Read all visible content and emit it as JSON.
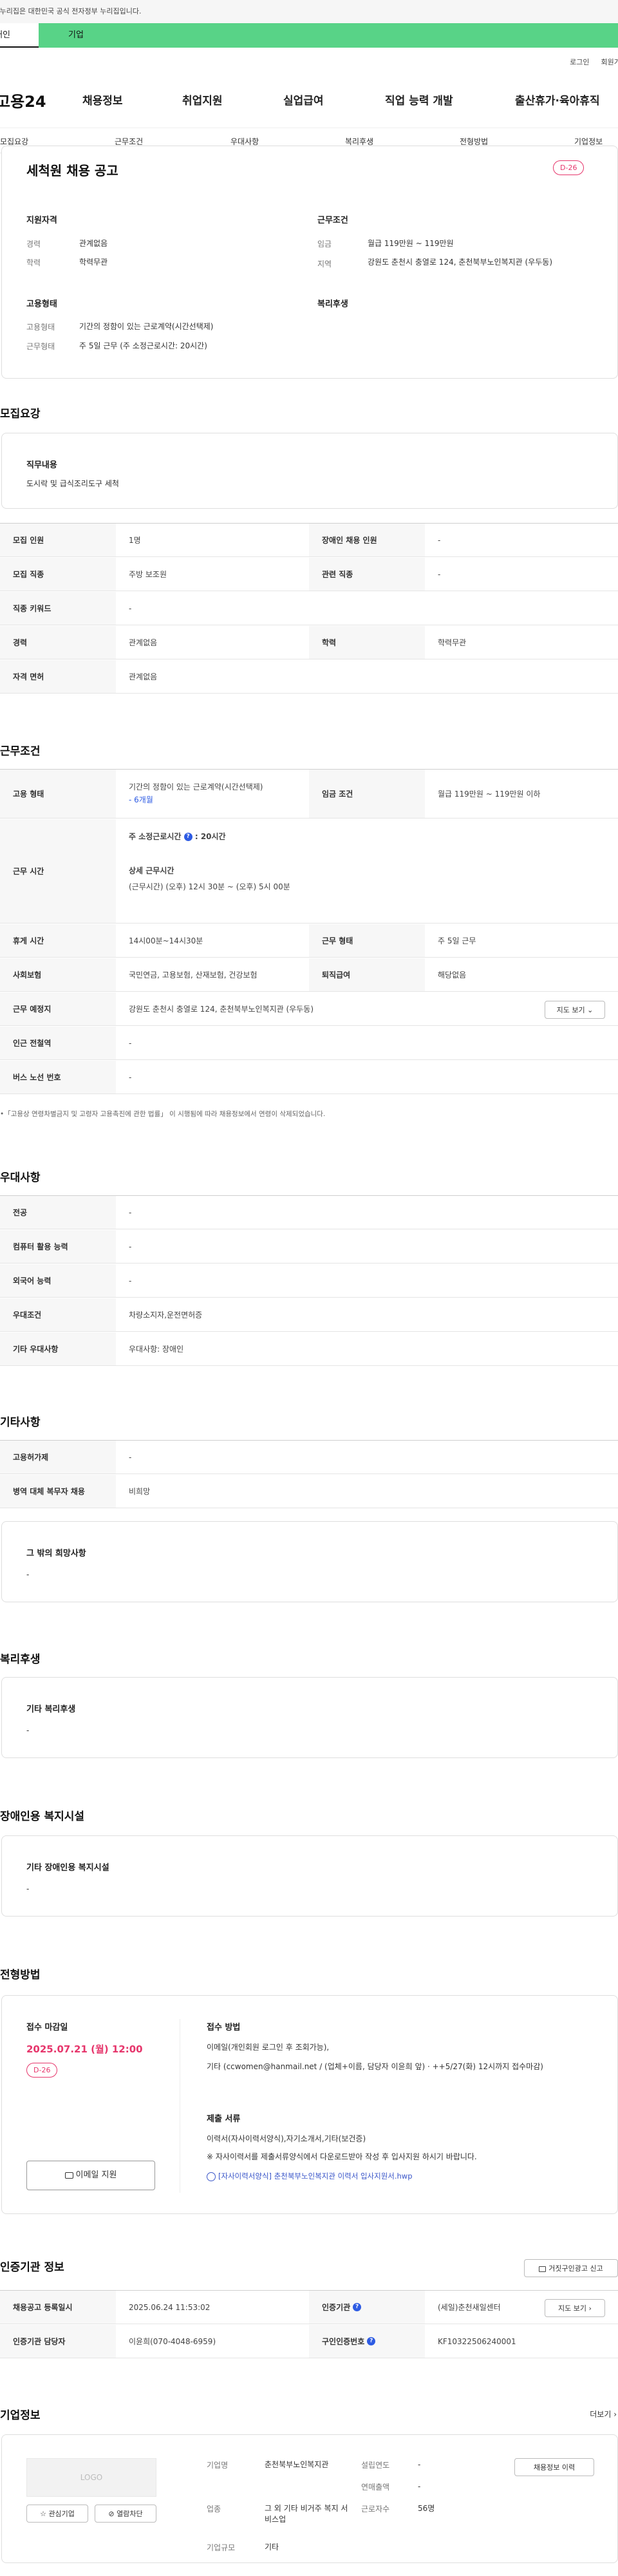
{
  "gov_banner": "이 누리집은 대한민국 공식 전자정부 누리집입니다.",
  "tabs": {
    "person": "개인",
    "company": "기업"
  },
  "utility": {
    "login": "로그인",
    "join": "회원가입"
  },
  "logo": "고용24",
  "gnb": [
    "채용정보",
    "취업지원",
    "실업급여",
    "직업 능력 개발",
    "출산휴가·육아휴직"
  ],
  "subnav": [
    "모집요강",
    "근무조건",
    "우대사항",
    "복리후생",
    "전형방법",
    "기업정보"
  ],
  "summary": {
    "title": "세척원 채용 공고",
    "dday": "D-26",
    "qualify_title": "지원자격",
    "career_k": "경력",
    "career_v": "관계없음",
    "edu_k": "학력",
    "edu_v": "학력무관",
    "cond_title": "근무조건",
    "wage_k": "임금",
    "wage_v": "월급 119만원 ~ 119만원",
    "region_k": "지역",
    "region_v": "강원도 춘천시 충열로 124, 춘천북부노인복지관 (우두동)",
    "emp_title": "고용형태",
    "emptype_k": "고용형태",
    "emptype_v": "기간의 정함이 있는 근로계약(시간선택제)",
    "worktype_k": "근무형태",
    "worktype_v": "주 5일 근무 (주 소정근로시간: 20시간)",
    "welfare_title": "복리후생"
  },
  "recruit": {
    "title": "모집요강",
    "duty_title": "직무내용",
    "duty_text": "도시락 및 급식조리도구 세척",
    "rows": [
      {
        "k1": "모집 인원",
        "v1": "1명",
        "k2": "장애인 채용 인원",
        "v2": "-"
      },
      {
        "k1": "모집 직종",
        "v1": "주방 보조원",
        "k2": "관련 직종",
        "v2": "-"
      },
      {
        "k1": "직종 키워드",
        "v1": "-"
      },
      {
        "k1": "경력",
        "v1": "관계없음",
        "k2": "학력",
        "v2": "학력무관"
      },
      {
        "k1": "자격 면허",
        "v1": "관계없음"
      }
    ]
  },
  "work": {
    "title": "근무조건",
    "emp_k": "고용 형태",
    "emp_v": "기간의 정함이 있는 근로계약(시간선택제)",
    "emp_period": "- 6개월",
    "wage_k": "임금 조건",
    "wage_v": "월급 119만원 ~ 119만원 이하",
    "time_k": "근무 시간",
    "time_hours_label": "주 소정근로시간",
    "time_hours_value": ": 20시간",
    "time_detail_label": "상세 근무시간",
    "time_detail_value": "(근무시간) (오후) 12시 30분 ~ (오후) 5시 00분",
    "rest_k": "휴게 시간",
    "rest_v": "14시00분~14시30분",
    "form_k": "근무 형태",
    "form_v": "주 5일 근무",
    "ins_k": "사회보험",
    "ins_v": "국민연금, 고용보험, 산재보험, 건강보험",
    "sev_k": "퇴직급여",
    "sev_v": "해당없음",
    "place_k": "근무 예정지",
    "place_v": "강원도 춘천시 충열로 124, 춘천북부노인복지관 (우두동)",
    "map_btn": "지도 보기",
    "subway_k": "인근 전철역",
    "subway_v": "-",
    "bus_k": "버스 노선 번호",
    "bus_v": "-",
    "footnote": "「고용상 연령차별금지 및 고령자 고용촉진에 관한 법률」 이 시행됨에 따라 채용정보에서 연령이 삭제되었습니다."
  },
  "pref": {
    "title": "우대사항",
    "rows": [
      {
        "k": "전공",
        "v": "-"
      },
      {
        "k": "컴퓨터 활용 능력",
        "v": "-"
      },
      {
        "k": "외국어 능력",
        "v": "-"
      },
      {
        "k": "우대조건",
        "v": "차량소지자,운전면허증"
      },
      {
        "k": "기타 우대사항",
        "v": "우대사항: 장애인"
      }
    ]
  },
  "etc": {
    "title": "기타사항",
    "rows": [
      {
        "k": "고용허가제",
        "v": "-"
      },
      {
        "k": "병역 대체 복무자 채용",
        "v": "비희망"
      }
    ],
    "hope_title": "그 밖의 희망사항",
    "hope_v": "-"
  },
  "welfare": {
    "title": "복리후생",
    "box_title": "기타 복리후생",
    "box_v": "-"
  },
  "disabled": {
    "title": "장애인용 복지시설",
    "box_title": "기타 장애인용 복지시설",
    "box_v": "-"
  },
  "process": {
    "title": "전형방법",
    "deadline_title": "접수 마감일",
    "deadline": "2025.07.21 (월) 12:00",
    "dday": "D-26",
    "apply_btn": "이메일 지원",
    "method_title": "접수 방법",
    "method_text": "이메일(개인회원 로그인 후 조회가능),",
    "method_text2": "기타 (ccwomen@hanmail.net / (업체+이름, 담당자 이윤희 앞) · ++5/27(화) 12시까지 접수마감)",
    "docs_title": "제출 서류",
    "docs_text": "이력서(자사이력서양식),자기소개서,기타(보건증)",
    "docs_note": "※ 자사이력서를 제출서류양식에서 다운로드받아 작성 후 입사지원 하시기 바랍니다.",
    "file_name": "[자사이력서양식] 춘천북부노인복지관 이력서 입사지원서.hwp"
  },
  "agency": {
    "title": "인증기관 정보",
    "report_btn": "거짓구인광고 신고",
    "date_k": "채용공고 등록일시",
    "date_v": "2025.06.24 11:53:02",
    "org_k": "인증기관",
    "org_v": "(세일)춘천새일센터",
    "map_btn": "지도 보기",
    "mgr_k": "인증기관 담당자",
    "mgr_v": "이윤희(070-4048-6959)",
    "num_k": "구인인증번호",
    "num_v": "KF10322506240001"
  },
  "company": {
    "title": "기업정보",
    "more": "더보기",
    "logo_text": "LOGO",
    "fav_btn": "관심기업",
    "block_btn": "열람차단",
    "name_k": "기업명",
    "name_v": "춘천북부노인복지관",
    "ind_k": "업종",
    "ind_v": "그 외 기타 비거주 복지 서비스업",
    "size_k": "기업규모",
    "size_v": "기타",
    "year_k": "설립연도",
    "year_v": "-",
    "sales_k": "연매출액",
    "sales_v": "-",
    "emp_k": "근로자수",
    "emp_v": "56명",
    "more_btn": "채용정보 이력"
  }
}
